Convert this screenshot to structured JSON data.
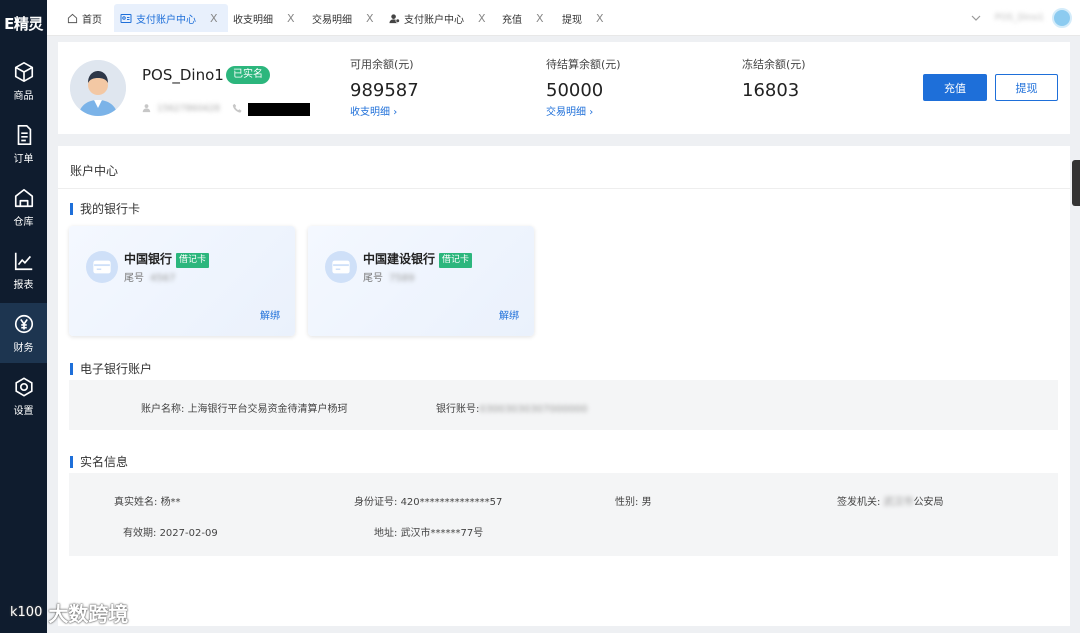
{
  "app": {
    "logo": "E精灵"
  },
  "sidebar": {
    "items": [
      {
        "label": "商品",
        "icon": "cube-icon",
        "active": false
      },
      {
        "label": "订单",
        "icon": "document-icon",
        "active": false
      },
      {
        "label": "仓库",
        "icon": "warehouse-icon",
        "active": false
      },
      {
        "label": "报表",
        "icon": "chart-icon",
        "active": false
      },
      {
        "label": "财务",
        "icon": "yuan-icon",
        "active": true
      },
      {
        "label": "设置",
        "icon": "gear-icon",
        "active": false
      }
    ]
  },
  "tabs": [
    {
      "label": "首页",
      "icon": "home-icon",
      "closable": false,
      "active": false
    },
    {
      "label": "支付账户中心",
      "icon": "id-card-icon",
      "closable": true,
      "active": true
    },
    {
      "label": "收支明细",
      "closable": true,
      "active": false
    },
    {
      "label": "交易明细",
      "closable": true,
      "active": false
    },
    {
      "label": "支付账户中心",
      "icon": "user-settings-icon",
      "closable": true,
      "active": false
    },
    {
      "label": "充值",
      "closable": true,
      "active": false
    },
    {
      "label": "提现",
      "closable": true,
      "active": false
    }
  ],
  "tab_close_glyph": "X",
  "user": {
    "name": "POS_Dino1"
  },
  "account": {
    "name": "POS_Dino1",
    "verified_badge": "已实名",
    "phone": "15627860428",
    "balances": [
      {
        "label": "可用余额(元)",
        "value": "989587",
        "link": "收支明细"
      },
      {
        "label": "待结算余额(元)",
        "value": "50000",
        "link": "交易明细"
      },
      {
        "label": "冻结余额(元)",
        "value": "16803",
        "link": ""
      }
    ],
    "recharge_button": "充值",
    "withdraw_button": "提现"
  },
  "center": {
    "title": "账户中心",
    "bank_section": "我的银行卡",
    "cards": [
      {
        "bank": "中国银行",
        "type": "借记卡",
        "tail_label": "尾号",
        "tail": "4567",
        "unbind": "解绑"
      },
      {
        "bank": "中国建设银行",
        "type": "借记卡",
        "tail_label": "尾号",
        "tail": "7589",
        "unbind": "解绑"
      }
    ],
    "ebank_section": "电子银行账户",
    "ebank": {
      "account_name_label": "账户名称:",
      "account_name": "上海银行平台交易资金待清算户杨珂",
      "account_no_label": "银行账号:",
      "account_no": "03003030307000000"
    },
    "realname_section": "实名信息",
    "realname": {
      "name_label": "真实姓名:",
      "name": "杨**",
      "id_label": "身份证号:",
      "id": "420**************57",
      "gender_label": "性别:",
      "gender": "男",
      "issuer_label": "签发机关:",
      "issuer_blur": "武汉市",
      "issuer_suffix": "公安局",
      "expiry_label": "有效期:",
      "expiry": "2027-02-09",
      "address_label": "地址:",
      "address": "武汉市******77号"
    }
  },
  "watermark": {
    "mark": "k100",
    "text": "大数跨境"
  },
  "colors": {
    "sidebar_bg": "#0f1c2e",
    "primary": "#1e6fd9",
    "success": "#2cb67d"
  }
}
